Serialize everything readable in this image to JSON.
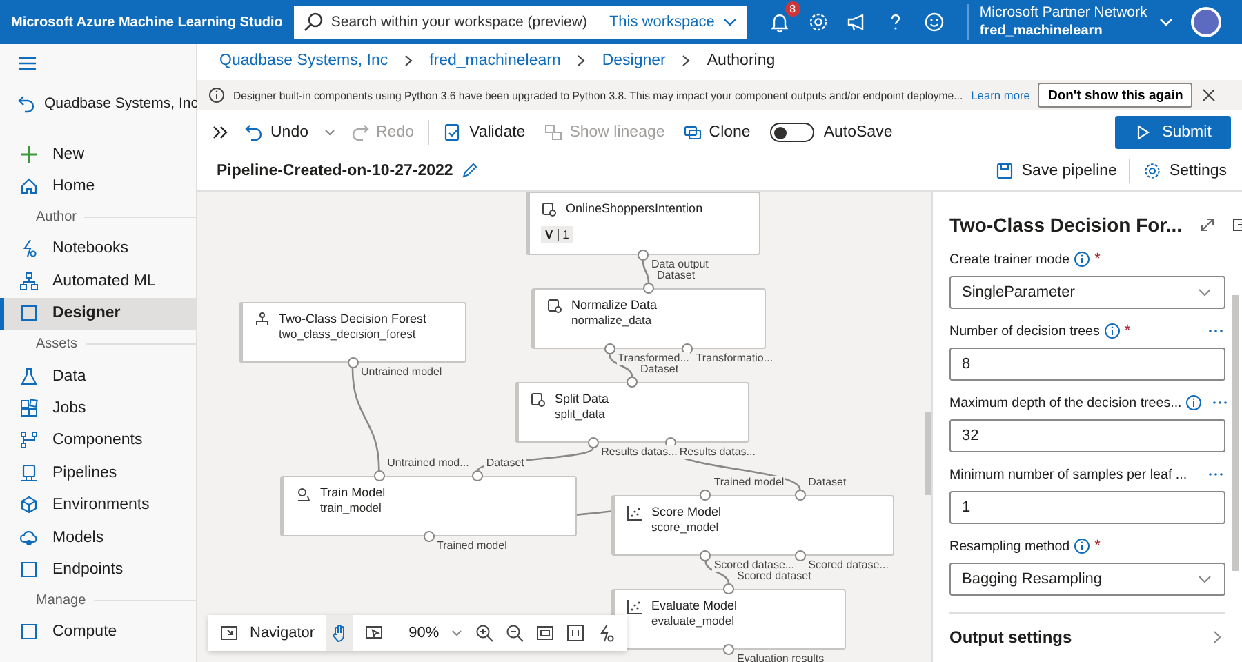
{
  "app": {
    "title": "Microsoft Azure Machine Learning Studio"
  },
  "search": {
    "placeholder": "Search within your workspace (preview)",
    "scope": "This workspace"
  },
  "notifications": {
    "count": "8"
  },
  "account": {
    "org": "Microsoft Partner Network",
    "workspace": "fred_machinelearn"
  },
  "sidebar": {
    "back": "Quadbase Systems, Inc",
    "items": [
      {
        "kind": "item",
        "label": "New",
        "selected": false
      },
      {
        "kind": "item",
        "label": "Home",
        "selected": false
      },
      {
        "kind": "heading",
        "label": "Author"
      },
      {
        "kind": "item",
        "label": "Notebooks",
        "selected": false
      },
      {
        "kind": "item",
        "label": "Automated ML",
        "selected": false
      },
      {
        "kind": "item",
        "label": "Designer",
        "selected": true
      },
      {
        "kind": "heading",
        "label": "Assets"
      },
      {
        "kind": "item",
        "label": "Data",
        "selected": false
      },
      {
        "kind": "item",
        "label": "Jobs",
        "selected": false
      },
      {
        "kind": "item",
        "label": "Components",
        "selected": false
      },
      {
        "kind": "item",
        "label": "Pipelines",
        "selected": false
      },
      {
        "kind": "item",
        "label": "Environments",
        "selected": false
      },
      {
        "kind": "item",
        "label": "Models",
        "selected": false
      },
      {
        "kind": "item",
        "label": "Endpoints",
        "selected": false
      },
      {
        "kind": "heading",
        "label": "Manage"
      },
      {
        "kind": "item",
        "label": "Compute",
        "selected": false
      }
    ]
  },
  "breadcrumbs": [
    "Quadbase Systems, Inc",
    "fred_machinelearn",
    "Designer",
    "Authoring"
  ],
  "banner": {
    "text": "Designer built-in components using Python 3.6 have been upgraded to Python 3.8. This may impact your component outputs and/or endpoint deployme...",
    "link": "Learn more",
    "button": "Don't show this again"
  },
  "toolbar": {
    "items": [
      {
        "label": "Undo",
        "disabled": false
      },
      {
        "label": "Redo",
        "disabled": true
      },
      {
        "label": "Validate",
        "disabled": false
      },
      {
        "label": "Show lineage",
        "disabled": true
      },
      {
        "label": "Clone",
        "disabled": false
      }
    ],
    "autosave": {
      "label": "AutoSave",
      "on": false
    },
    "submit": "Submit"
  },
  "pipeline": {
    "title": "Pipeline-Created-on-10-27-2022",
    "save": "Save pipeline",
    "settings": "Settings"
  },
  "nodes": [
    {
      "title": "OnlineShoppersIntention",
      "version_label": "V",
      "version": "1",
      "outputs": [
        "Data output"
      ]
    },
    {
      "title": "Normalize Data",
      "name": "normalize_data",
      "inputs": [
        "Dataset"
      ],
      "outputs": [
        "Transformed...",
        "Transformatio..."
      ]
    },
    {
      "title": "Two-Class Decision Forest",
      "name": "two_class_decision_forest",
      "outputs": [
        "Untrained model"
      ]
    },
    {
      "title": "Split Data",
      "name": "split_data",
      "inputs": [
        "Dataset"
      ],
      "outputs": [
        "Results datas...",
        "Results datas..."
      ]
    },
    {
      "title": "Train Model",
      "name": "train_model",
      "inputs": [
        "Untrained mod...",
        "Dataset"
      ],
      "outputs": [
        "Trained model"
      ]
    },
    {
      "title": "Score Model",
      "name": "score_model",
      "inputs": [
        "Trained model",
        "Dataset"
      ],
      "outputs": [
        "Scored datase...",
        "Scored datase..."
      ]
    },
    {
      "title": "Evaluate Model",
      "name": "evaluate_model",
      "inputs": [
        "Scored dataset"
      ],
      "outputs": [
        "Evaluation results"
      ]
    }
  ],
  "navigator": {
    "label": "Navigator",
    "pan_selected": true,
    "zoom": "90%"
  },
  "panel": {
    "title": "Two-Class Decision For...",
    "fields": [
      {
        "kind": "select",
        "label": "Create trainer mode",
        "info": true,
        "required_mark": "*",
        "value": "SingleParameter"
      },
      {
        "kind": "input",
        "label": "Number of decision trees",
        "info": true,
        "required_mark": "*",
        "more": true,
        "value": "8"
      },
      {
        "kind": "input",
        "label": "Maximum depth of the decision trees...",
        "info": true,
        "more": true,
        "value": "32"
      },
      {
        "kind": "input",
        "label": "Minimum number of samples per leaf ...",
        "more": true,
        "value": "1"
      },
      {
        "kind": "select",
        "label": "Resampling method",
        "info": true,
        "required_mark": "*",
        "value": "Bagging Resampling"
      }
    ],
    "section": "Output settings"
  }
}
